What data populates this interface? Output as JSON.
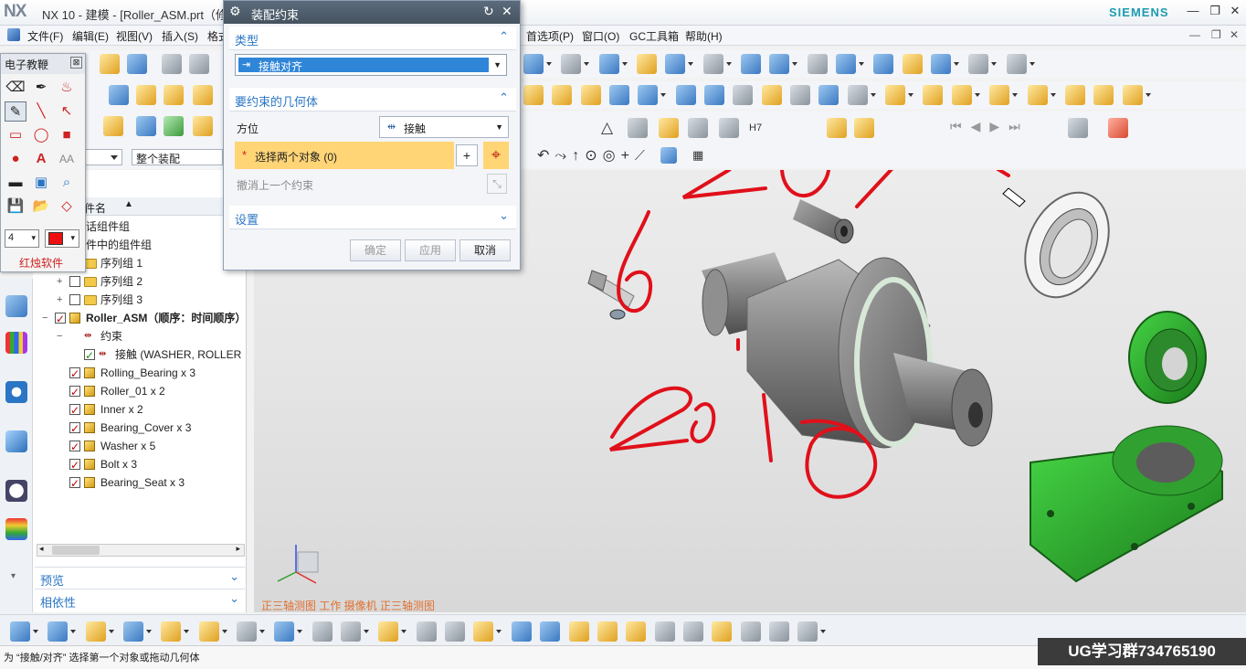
{
  "app": {
    "logo": "NX",
    "title": "NX 10 - 建模 - [Roller_ASM.prt（修",
    "brand": "SIEMENS"
  },
  "menu": {
    "items": [
      "文件(F)",
      "编辑(E)",
      "视图(V)",
      "插入(S)",
      "格式"
    ],
    "right_items": [
      "首选项(P)",
      "窗口(O)",
      "GC工具箱",
      "帮助(H)"
    ]
  },
  "tutorial": {
    "title": "电子教鞭",
    "line_width": "4",
    "caption": "红烛软件"
  },
  "dialog": {
    "title": "装配约束",
    "type_section": "类型",
    "type_value": "接触对齐",
    "geometry_section": "要约束的几何体",
    "orientation_label": "方位",
    "orientation_value": "接触",
    "select_label": "选择两个对象 (0)",
    "undo_label": "撤消上一个约束",
    "settings_section": "设置",
    "ok": "确定",
    "apply": "应用",
    "cancel": "取消"
  },
  "filters": {
    "scope_value": "整个装配"
  },
  "constraint_toolbar": {
    "fit_label": "H7"
  },
  "nav": {
    "column_header": "件名",
    "rows": [
      {
        "label": "话组件组",
        "indent": 1
      },
      {
        "label": "件中的组件组",
        "indent": 1
      },
      {
        "label": "序列组 1",
        "indent": 2
      },
      {
        "label": "序列组 2",
        "indent": 2
      },
      {
        "label": "序列组 3",
        "indent": 2
      },
      {
        "label": "Roller_ASM（顺序：时间顺序）",
        "indent": 1
      },
      {
        "label": "约束",
        "indent": 2
      },
      {
        "label": "接触 (WASHER, ROLLER",
        "indent": 3
      },
      {
        "label": "Rolling_Bearing x 3",
        "indent": 2
      },
      {
        "label": "Roller_01 x 2",
        "indent": 2
      },
      {
        "label": "Inner x 2",
        "indent": 2
      },
      {
        "label": "Bearing_Cover x 3",
        "indent": 2
      },
      {
        "label": "Washer x 5",
        "indent": 2
      },
      {
        "label": "Bolt x 3",
        "indent": 2
      },
      {
        "label": "Bearing_Seat x 3",
        "indent": 2
      }
    ],
    "preview": "预览",
    "dependency": "相依性"
  },
  "viewport": {
    "label": "正三轴测图 工作 摄像机 正三轴测图",
    "annotations": [
      "20",
      "6",
      "2010"
    ],
    "colors": {
      "green_part": "#2ea82e",
      "annotation": "#e0101a"
    }
  },
  "status": {
    "message": "为 “接触/对齐” 选择第一个对象或拖动几何体"
  },
  "watermark": "UG学习群734765190"
}
